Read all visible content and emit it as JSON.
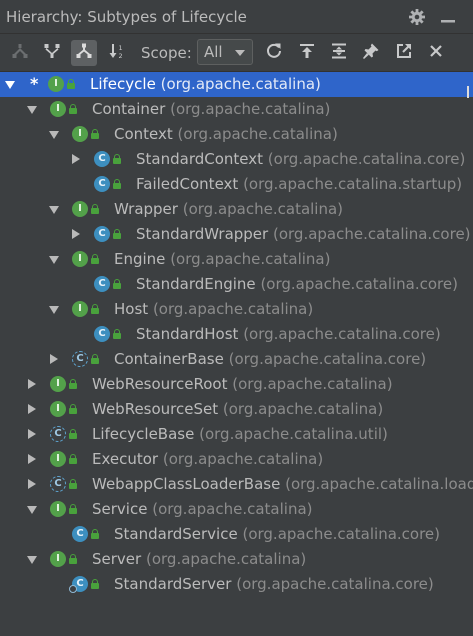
{
  "title": "Hierarchy:  Subtypes of Lifecycle",
  "title_icons": [
    "gear-icon",
    "minimize-icon"
  ],
  "toolbar": {
    "buttons": [
      {
        "name": "supertypes-hierarchy-button",
        "icon": "supertypes-icon",
        "active": false
      },
      {
        "name": "class-hierarchy-button",
        "icon": "class-hierarchy-icon",
        "active": false
      },
      {
        "name": "subtypes-hierarchy-button",
        "icon": "subtypes-icon",
        "active": true
      },
      {
        "name": "sort-alphabetically-button",
        "icon": "sort-icon",
        "active": false
      }
    ],
    "scope_label": "Scope:",
    "scope_value": "All",
    "right_buttons": [
      "refresh-icon",
      "export-icon",
      "expand-all-icon",
      "pin-icon",
      "open-in-window-icon",
      "close-icon"
    ]
  },
  "tree": [
    {
      "depth": 0,
      "arrow": "down",
      "star": "*",
      "kind": "interface",
      "name": "Lifecycle",
      "pkg": "(org.apache.catalina)",
      "selected": true
    },
    {
      "depth": 1,
      "arrow": "down",
      "kind": "interface",
      "name": "Container",
      "pkg": "(org.apache.catalina)"
    },
    {
      "depth": 2,
      "arrow": "down",
      "kind": "interface",
      "name": "Context",
      "pkg": "(org.apache.catalina)"
    },
    {
      "depth": 3,
      "arrow": "right",
      "kind": "class",
      "name": "StandardContext",
      "pkg": "(org.apache.catalina.core)"
    },
    {
      "depth": 3,
      "arrow": "none",
      "kind": "class",
      "name": "FailedContext",
      "pkg": "(org.apache.catalina.startup)"
    },
    {
      "depth": 2,
      "arrow": "down",
      "kind": "interface",
      "name": "Wrapper",
      "pkg": "(org.apache.catalina)"
    },
    {
      "depth": 3,
      "arrow": "right",
      "kind": "class",
      "name": "StandardWrapper",
      "pkg": "(org.apache.catalina.core)"
    },
    {
      "depth": 2,
      "arrow": "down",
      "kind": "interface",
      "name": "Engine",
      "pkg": "(org.apache.catalina)"
    },
    {
      "depth": 3,
      "arrow": "none",
      "kind": "class",
      "name": "StandardEngine",
      "pkg": "(org.apache.catalina.core)"
    },
    {
      "depth": 2,
      "arrow": "down",
      "kind": "interface",
      "name": "Host",
      "pkg": "(org.apache.catalina)"
    },
    {
      "depth": 3,
      "arrow": "none",
      "kind": "class",
      "name": "StandardHost",
      "pkg": "(org.apache.catalina.core)"
    },
    {
      "depth": 2,
      "arrow": "right",
      "kind": "abstract",
      "name": "ContainerBase",
      "pkg": "(org.apache.catalina.core)"
    },
    {
      "depth": 1,
      "arrow": "right",
      "kind": "interface",
      "name": "WebResourceRoot",
      "pkg": "(org.apache.catalina)"
    },
    {
      "depth": 1,
      "arrow": "right",
      "kind": "interface",
      "name": "WebResourceSet",
      "pkg": "(org.apache.catalina)"
    },
    {
      "depth": 1,
      "arrow": "right",
      "kind": "abstract",
      "name": "LifecycleBase",
      "pkg": "(org.apache.catalina.util)"
    },
    {
      "depth": 1,
      "arrow": "right",
      "kind": "interface",
      "name": "Executor",
      "pkg": "(org.apache.catalina)"
    },
    {
      "depth": 1,
      "arrow": "right",
      "kind": "abstract",
      "name": "WebappClassLoaderBase",
      "pkg": "(org.apache.catalina.loade"
    },
    {
      "depth": 1,
      "arrow": "down",
      "kind": "interface",
      "name": "Service",
      "pkg": "(org.apache.catalina)"
    },
    {
      "depth": 2,
      "arrow": "none",
      "kind": "class",
      "name": "StandardService",
      "pkg": "(org.apache.catalina.core)"
    },
    {
      "depth": 1,
      "arrow": "down",
      "kind": "interface",
      "name": "Server",
      "pkg": "(org.apache.catalina)"
    },
    {
      "depth": 2,
      "arrow": "none",
      "kind": "class-special",
      "name": "StandardServer",
      "pkg": "(org.apache.catalina.core)"
    }
  ],
  "badge_letters": {
    "interface": "I",
    "class": "C",
    "abstract": "C",
    "class-special": "C"
  },
  "colors": {
    "background": "#3c3f41",
    "selection": "#2f65ca",
    "interface_badge": "#53a14a",
    "class_badge": "#3d8fbf"
  }
}
